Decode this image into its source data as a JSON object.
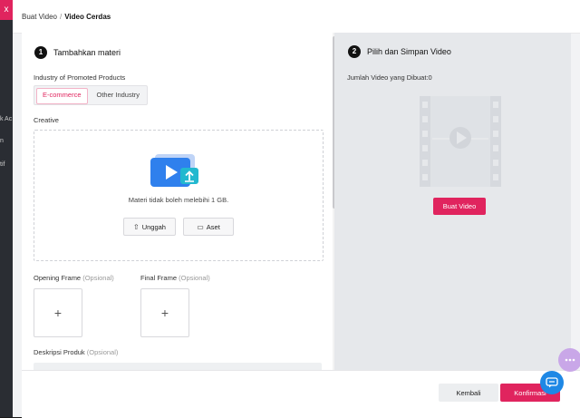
{
  "backdrop": {
    "close_icon": "x",
    "texts": [
      "k Ac",
      "n",
      "tif"
    ]
  },
  "header": {
    "breadcrumb": [
      {
        "label": "Buat Video"
      },
      {
        "label": "Video Cerdas"
      }
    ],
    "separator": "/"
  },
  "left": {
    "step_number": "1",
    "step_title": "Tambahkan materi",
    "industry_label": "Industry of Promoted Products",
    "industry_options": [
      "E-commerce",
      "Other Industry"
    ],
    "industry_selected": "E-commerce",
    "creative_label": "Creative",
    "upload_hint": "Materi tidak boleh melebihi 1 GB.",
    "upload_button": "Unggah",
    "assets_button": "Aset",
    "opening_frame_label": "Opening Frame",
    "final_frame_label": "Final Frame",
    "optional_text": "(Opsional)",
    "description_label": "Deskripsi Produk",
    "plus_glyph": "+"
  },
  "right": {
    "step_number": "2",
    "step_title": "Pilih dan Simpan Video",
    "count_text": "Jumlah Video yang Dibuat:0",
    "create_button": "Buat Video"
  },
  "footer": {
    "back_button": "Kembali",
    "confirm_button": "Konfirmasi"
  },
  "colors": {
    "accent": "#e0245e",
    "chat": "#1e88e5"
  }
}
